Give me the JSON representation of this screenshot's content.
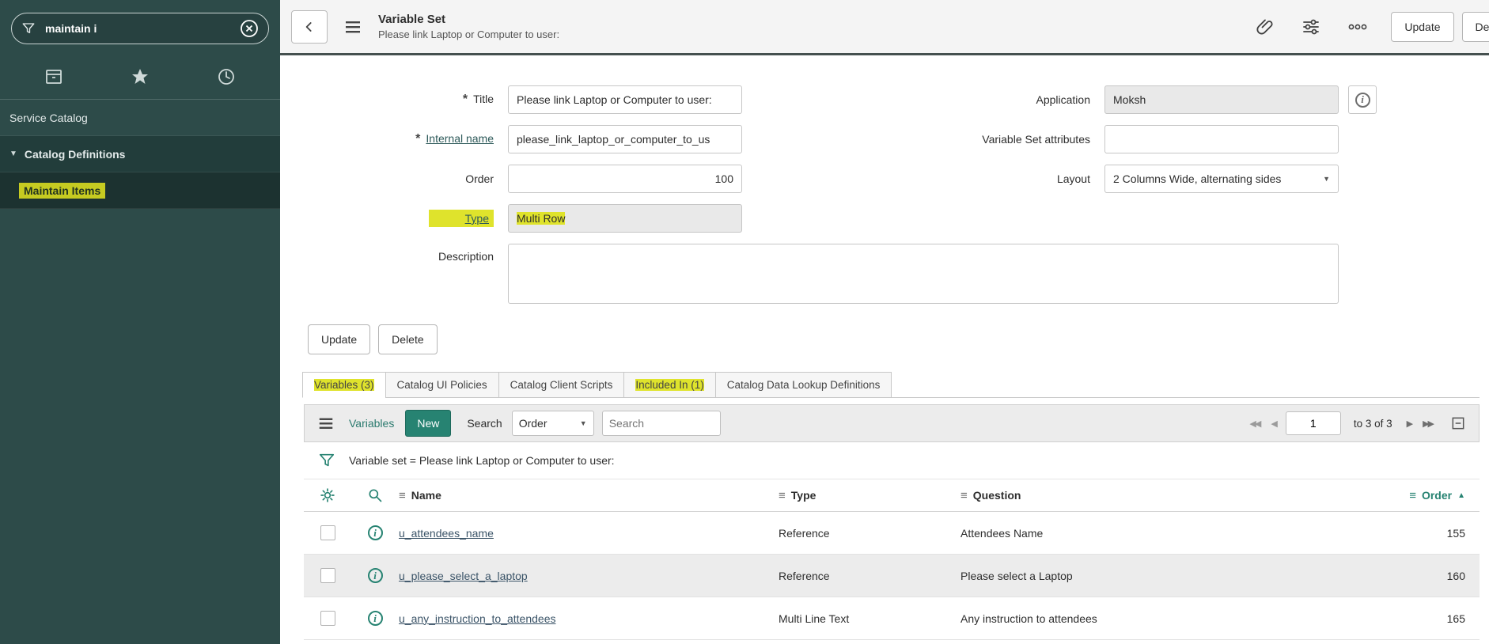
{
  "colors": {
    "accent": "#278372",
    "highlight": "#dfe32c",
    "sidebar_bg": "#2d4b49"
  },
  "sidebar": {
    "search_value": "maintain i",
    "service_catalog_label": "Service Catalog",
    "catalog_definitions_label": "Catalog Definitions",
    "maintain_items_label": "Maintain Items"
  },
  "header": {
    "title": "Variable Set",
    "subtitle": "Please link Laptop or Computer to user:",
    "update_label": "Update",
    "delete_label": "Delete"
  },
  "form": {
    "required_marker": "*",
    "title_label": "Title",
    "title_value": "Please link Laptop or Computer to user:",
    "internal_name_label": "Internal name",
    "internal_name_value": "please_link_laptop_or_computer_to_us",
    "order_label": "Order",
    "order_value": "100",
    "type_label": "Type",
    "type_value": "Multi Row",
    "description_label": "Description",
    "description_value": "",
    "application_label": "Application",
    "application_value": "Moksh",
    "attributes_label": "Variable Set attributes",
    "attributes_value": "",
    "layout_label": "Layout",
    "layout_value": "2 Columns Wide, alternating sides",
    "update_label": "Update",
    "delete_label": "Delete"
  },
  "tabs": [
    {
      "label": "Variables (3)"
    },
    {
      "label": "Catalog UI Policies"
    },
    {
      "label": "Catalog Client Scripts"
    },
    {
      "label": "Included In (1)"
    },
    {
      "label": "Catalog Data Lookup Definitions"
    }
  ],
  "list": {
    "title": "Variables",
    "new_label": "New",
    "search_label": "Search",
    "search_field": "Order",
    "search_placeholder": "Search",
    "page_value": "1",
    "page_range": "to 3 of 3",
    "filter_text": "Variable set = Please link Laptop or Computer to user:",
    "columns": [
      "Name",
      "Type",
      "Question",
      "Order"
    ],
    "rows": [
      {
        "name": "u_attendees_name",
        "type": "Reference",
        "question": "Attendees Name",
        "order": "155"
      },
      {
        "name": "u_please_select_a_laptop",
        "type": "Reference",
        "question": "Please select a Laptop",
        "order": "160"
      },
      {
        "name": "u_any_instruction_to_attendees",
        "type": "Multi Line Text",
        "question": "Any instruction to attendees",
        "order": "165"
      }
    ]
  },
  "icons": {
    "first_page": "◀◀",
    "prev_page": "◀",
    "next_page": "▶",
    "last_page": "▶▶",
    "sort_ascending": "▲",
    "caret_down": "▼",
    "column_menu": "≡",
    "collapse_section": "▼"
  }
}
